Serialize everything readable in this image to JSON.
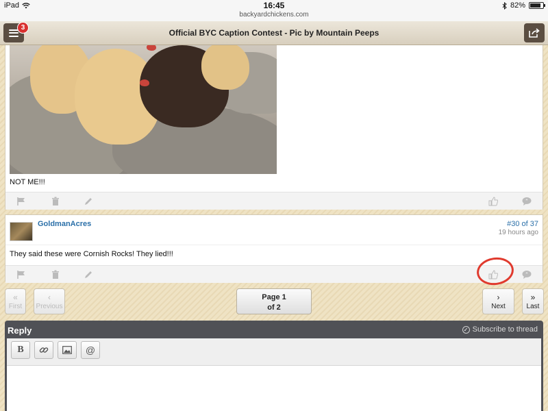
{
  "status_bar": {
    "device": "iPad",
    "time": "16:45",
    "url": "backyardchickens.com",
    "battery": "82%",
    "battery_level": 0.82
  },
  "header": {
    "title": "Official BYC Caption Contest - Pic by Mountain Peeps",
    "notification_count": "3",
    "menu_icon": "hamburger-icon",
    "share_icon": "share-icon"
  },
  "posts": [
    {
      "text": "NOT ME!!!",
      "actions": [
        "flag-icon",
        "trash-icon",
        "pencil-icon",
        "thumbs-up-icon",
        "quote-icon"
      ]
    },
    {
      "username": "GoldmanAcres",
      "post_number": "#30 of 37",
      "time": "19 hours ago",
      "text": "They said these were Cornish Rocks!  They lied!!!",
      "actions": [
        "flag-icon",
        "trash-icon",
        "pencil-icon",
        "thumbs-up-icon",
        "quote-icon"
      ]
    }
  ],
  "pagination": {
    "first_arrow": "«",
    "first": "First",
    "previous_arrow": "‹",
    "previous": "Previous",
    "page_line1": "Page 1",
    "page_line2": "of 2",
    "next_arrow": "›",
    "next": "Next",
    "last_arrow": "»",
    "last": "Last"
  },
  "reply": {
    "title": "Reply",
    "subscribe": "Subscribe to thread",
    "toolbar": {
      "bold": "B",
      "mention": "@"
    }
  },
  "colors": {
    "link": "#2a6fa8",
    "header_button": "#5b4e42",
    "badge": "#d9312f",
    "annotation_circle": "#e03a2e",
    "reply_bar": "#505156"
  }
}
